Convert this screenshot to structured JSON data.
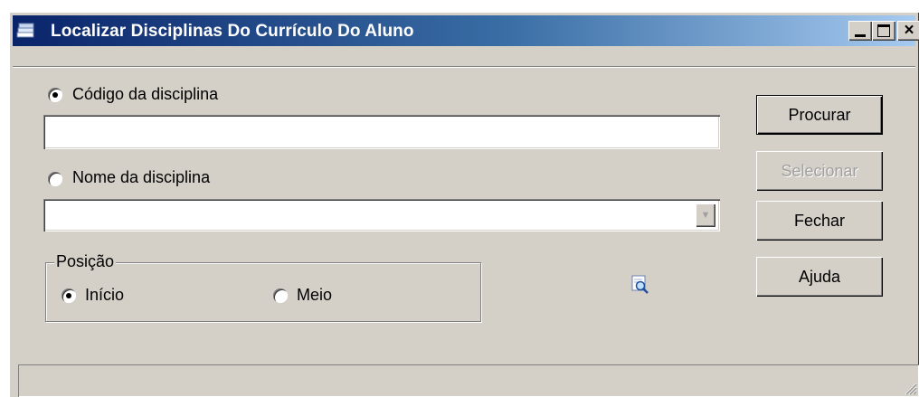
{
  "window": {
    "title": "Localizar Disciplinas Do Currículo Do Aluno",
    "title_icon": "books-icon",
    "controls": {
      "minimize": "minimize-icon",
      "maximize": "maximize-icon",
      "close": "×"
    }
  },
  "search": {
    "code_option": {
      "label": "Código da disciplina",
      "selected": true,
      "value": ""
    },
    "name_option": {
      "label": "Nome da disciplina",
      "selected": false,
      "value": ""
    }
  },
  "position": {
    "legend": "Posição",
    "options": [
      {
        "label": "Início",
        "selected": true
      },
      {
        "label": "Meio",
        "selected": false
      }
    ]
  },
  "buttons": {
    "search": "Procurar",
    "select": "Selecionar",
    "close": "Fechar",
    "help": "Ajuda"
  },
  "status": {
    "text": ""
  },
  "colors": {
    "title_gradient_start": "#0a246a",
    "title_gradient_end": "#a6caf0",
    "face": "#d4d0c8"
  }
}
